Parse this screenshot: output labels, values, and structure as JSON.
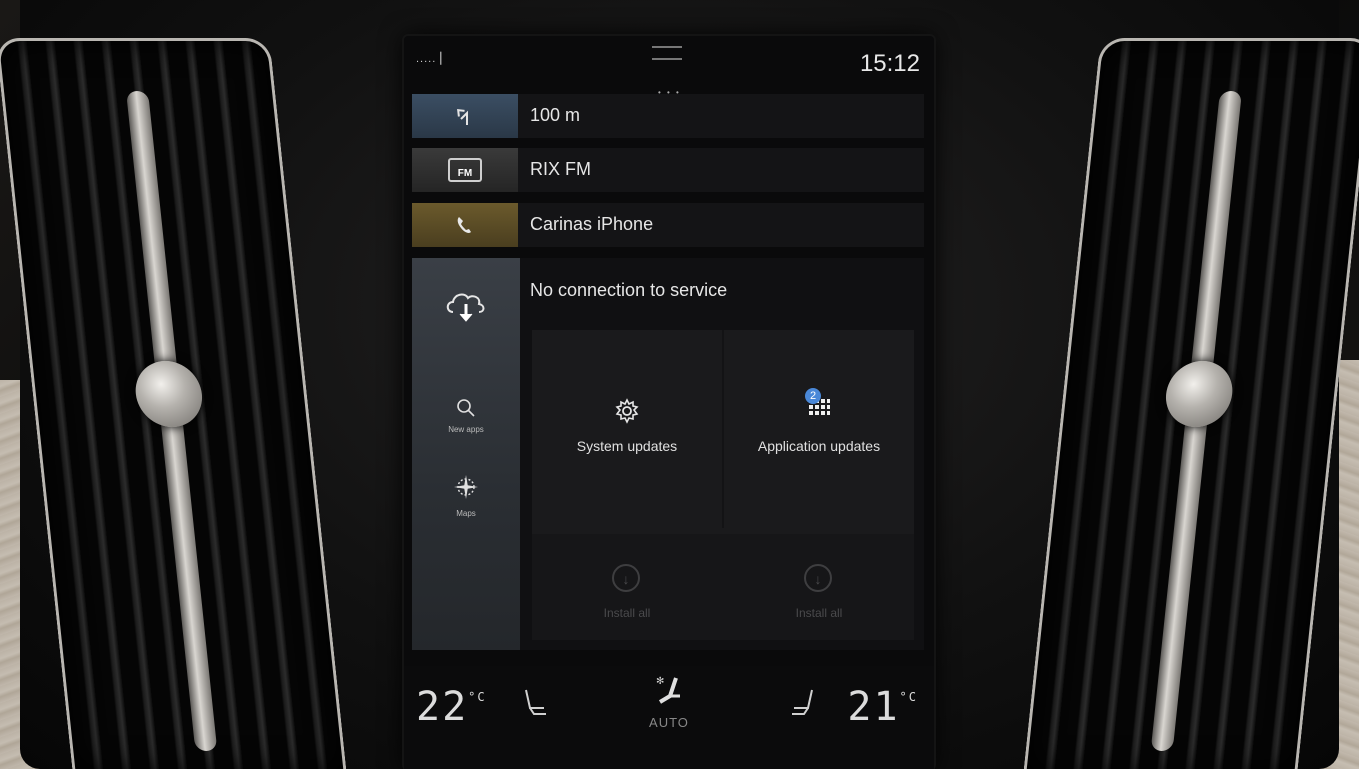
{
  "status": {
    "signal": "..... ▏",
    "clock": "15:12"
  },
  "tiles": {
    "navigation": {
      "text": "100 m",
      "icon": "turn-left-arrow-icon"
    },
    "media": {
      "text": "RIX FM",
      "badge": "FM",
      "icon": "radio-icon"
    },
    "phone": {
      "text": "Carinas iPhone",
      "icon": "phone-icon"
    }
  },
  "side_rail": {
    "items": [
      {
        "icon": "cloud-download-icon",
        "label": ""
      },
      {
        "icon": "search-icon",
        "label": "New apps"
      },
      {
        "icon": "compass-icon",
        "label": "Maps"
      }
    ]
  },
  "panel": {
    "title": "No connection to service",
    "system_updates": {
      "label": "System updates",
      "icon": "gear-icon"
    },
    "application_updates": {
      "label": "Application updates",
      "icon": "apps-grid-icon",
      "badge": "2"
    },
    "install_all_1": {
      "label": "Install all",
      "icon": "download-icon"
    },
    "install_all_2": {
      "label": "Install all",
      "icon": "download-icon"
    }
  },
  "climate": {
    "left_temp": "22",
    "right_temp": "21",
    "unit": "°C",
    "auto_label": "AUTO",
    "left_seat_icon": "seat-heat-icon",
    "right_seat_icon": "seat-heat-icon",
    "fan_icon": "fan-seat-icon"
  }
}
